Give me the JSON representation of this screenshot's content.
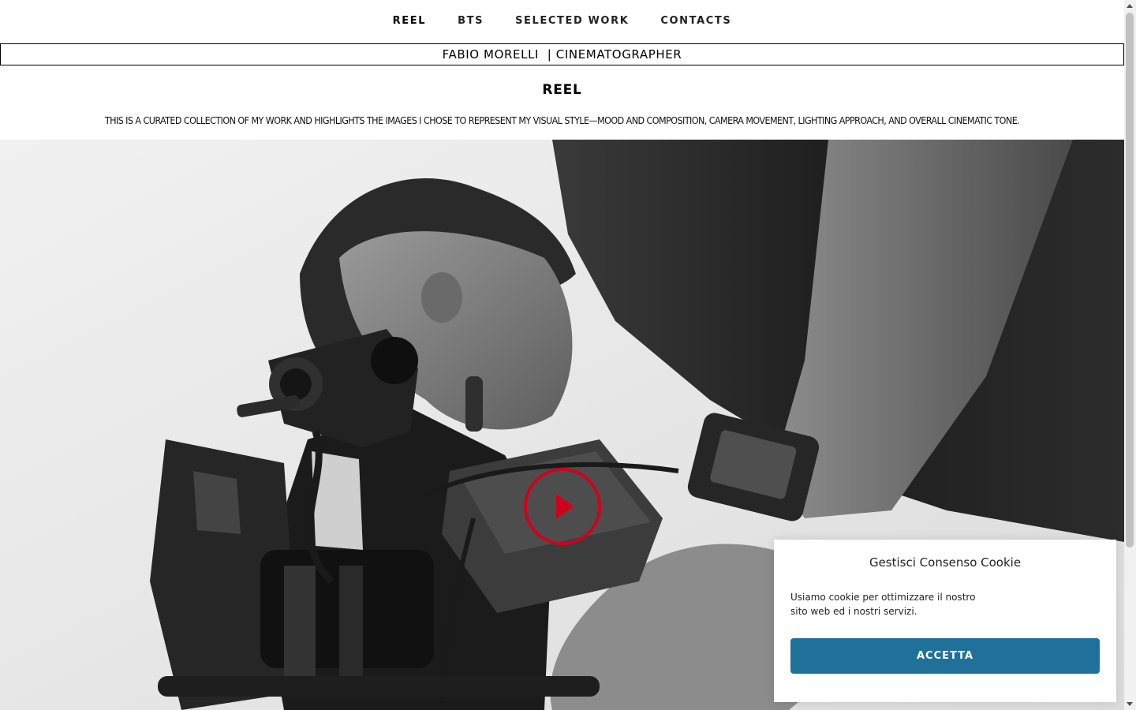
{
  "nav": {
    "items": [
      {
        "label": "REEL",
        "active": true
      },
      {
        "label": "BTS",
        "active": false
      },
      {
        "label": "SELECTED WORK",
        "active": false
      },
      {
        "label": "CONTACTS",
        "active": false
      }
    ]
  },
  "site_title": "FABIO MORELLI  | CINEMATOGRAPHER",
  "section": {
    "title": "REEL",
    "description": "THIS IS A CURATED COLLECTION OF MY WORK AND HIGHLIGHTS THE IMAGES I CHOSE TO REPRESENT MY VISUAL STYLE—MOOD AND COMPOSITION, CAMERA MOVEMENT, LIGHTING APPROACH, AND OVERALL CINEMATIC TONE."
  },
  "hero": {
    "play_icon": "play-icon",
    "play_color": "#d0021b"
  },
  "cookie": {
    "title": "Gestisci Consenso Cookie",
    "text": "Usiamo cookie per ottimizzare il nostro sito web ed i nostri servizi.",
    "accept_label": "ACCETTA",
    "button_color": "#1f7199"
  }
}
